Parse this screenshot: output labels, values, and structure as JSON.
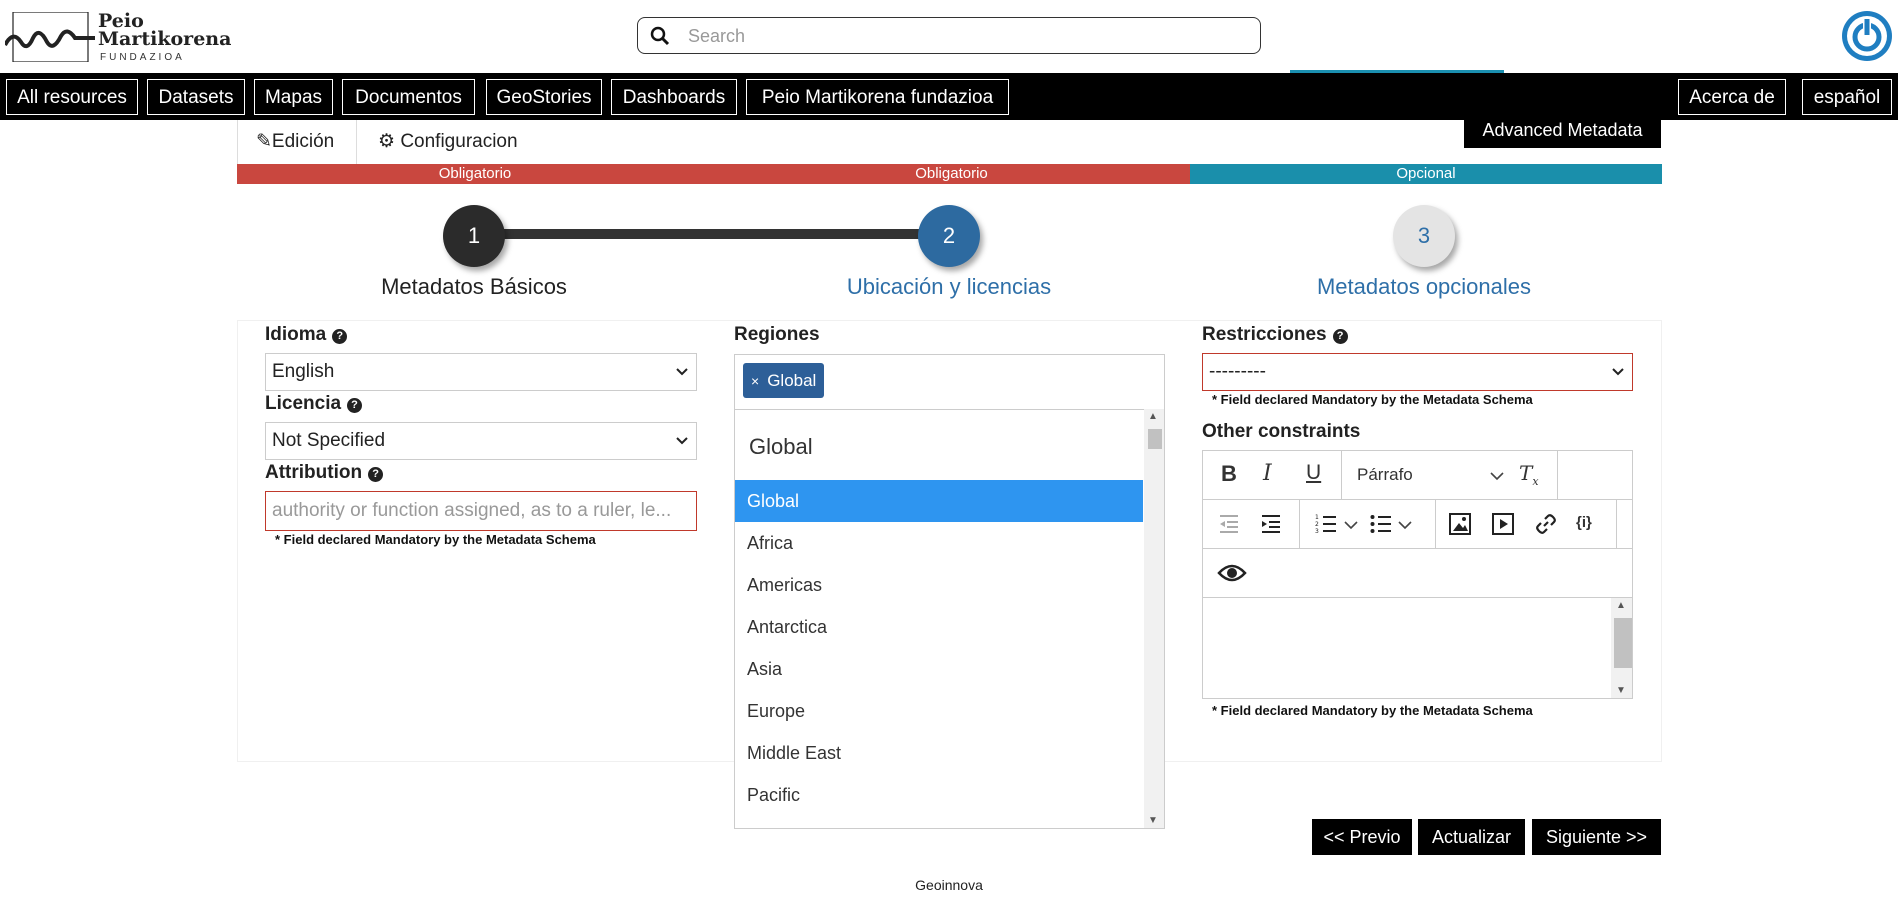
{
  "logo": {
    "line1": "Peio",
    "line2": "Martikorena",
    "line3": "FUNDAZIOA"
  },
  "search": {
    "placeholder": "Search"
  },
  "nav": {
    "left": [
      "All resources",
      "Datasets",
      "Mapas",
      "Documentos",
      "GeoStories",
      "Dashboards",
      "Peio Martikorena fundazioa"
    ],
    "about": "Acerca de",
    "language": "español"
  },
  "tabs": {
    "edit": "Edición",
    "config": "Configuracion",
    "advanced": "Advanced Metadata"
  },
  "progress": {
    "seg1": "Obligatorio",
    "seg2": "Obligatorio",
    "seg3": "Opcional",
    "colors": {
      "mandatory": "#c9473f",
      "optional": "#1a8fab"
    }
  },
  "steps": [
    {
      "number": "1",
      "label": "Metadatos Básicos"
    },
    {
      "number": "2",
      "label": "Ubicación y licencias"
    },
    {
      "number": "3",
      "label": "Metadatos opcionales"
    }
  ],
  "form": {
    "idioma": {
      "label": "Idioma",
      "value": "English"
    },
    "licencia": {
      "label": "Licencia",
      "value": "Not Specified"
    },
    "attribution": {
      "label": "Attribution",
      "placeholder": "authority or function assigned, as to a ruler, le...",
      "mandatory_note": "* Field declared Mandatory by the Metadata Schema"
    },
    "regiones": {
      "label": "Regiones",
      "chip": "Global",
      "chip_remove": "×",
      "search_text": "Global",
      "options": [
        "Global",
        "Africa",
        "Americas",
        "Antarctica",
        "Asia",
        "Europe",
        "Middle East",
        "Pacific"
      ],
      "selected": "Global"
    },
    "restricciones": {
      "label": "Restricciones",
      "value": "---------",
      "mandatory_note": "* Field declared Mandatory by the Metadata Schema"
    },
    "other_constraints": {
      "label": "Other constraints",
      "paragraph_select": "Párrafo",
      "mandatory_note": "* Field declared Mandatory by the Metadata Schema"
    }
  },
  "buttons": {
    "prev": "<< Previo",
    "update": "Actualizar",
    "next": "Siguiente >>"
  },
  "footer": "Geoinnova",
  "colors": {
    "step_active": "#2d6aa0",
    "step_done": "#2b2b2b",
    "accent_blue": "#2e6fa8",
    "error_red": "#c0392b"
  }
}
